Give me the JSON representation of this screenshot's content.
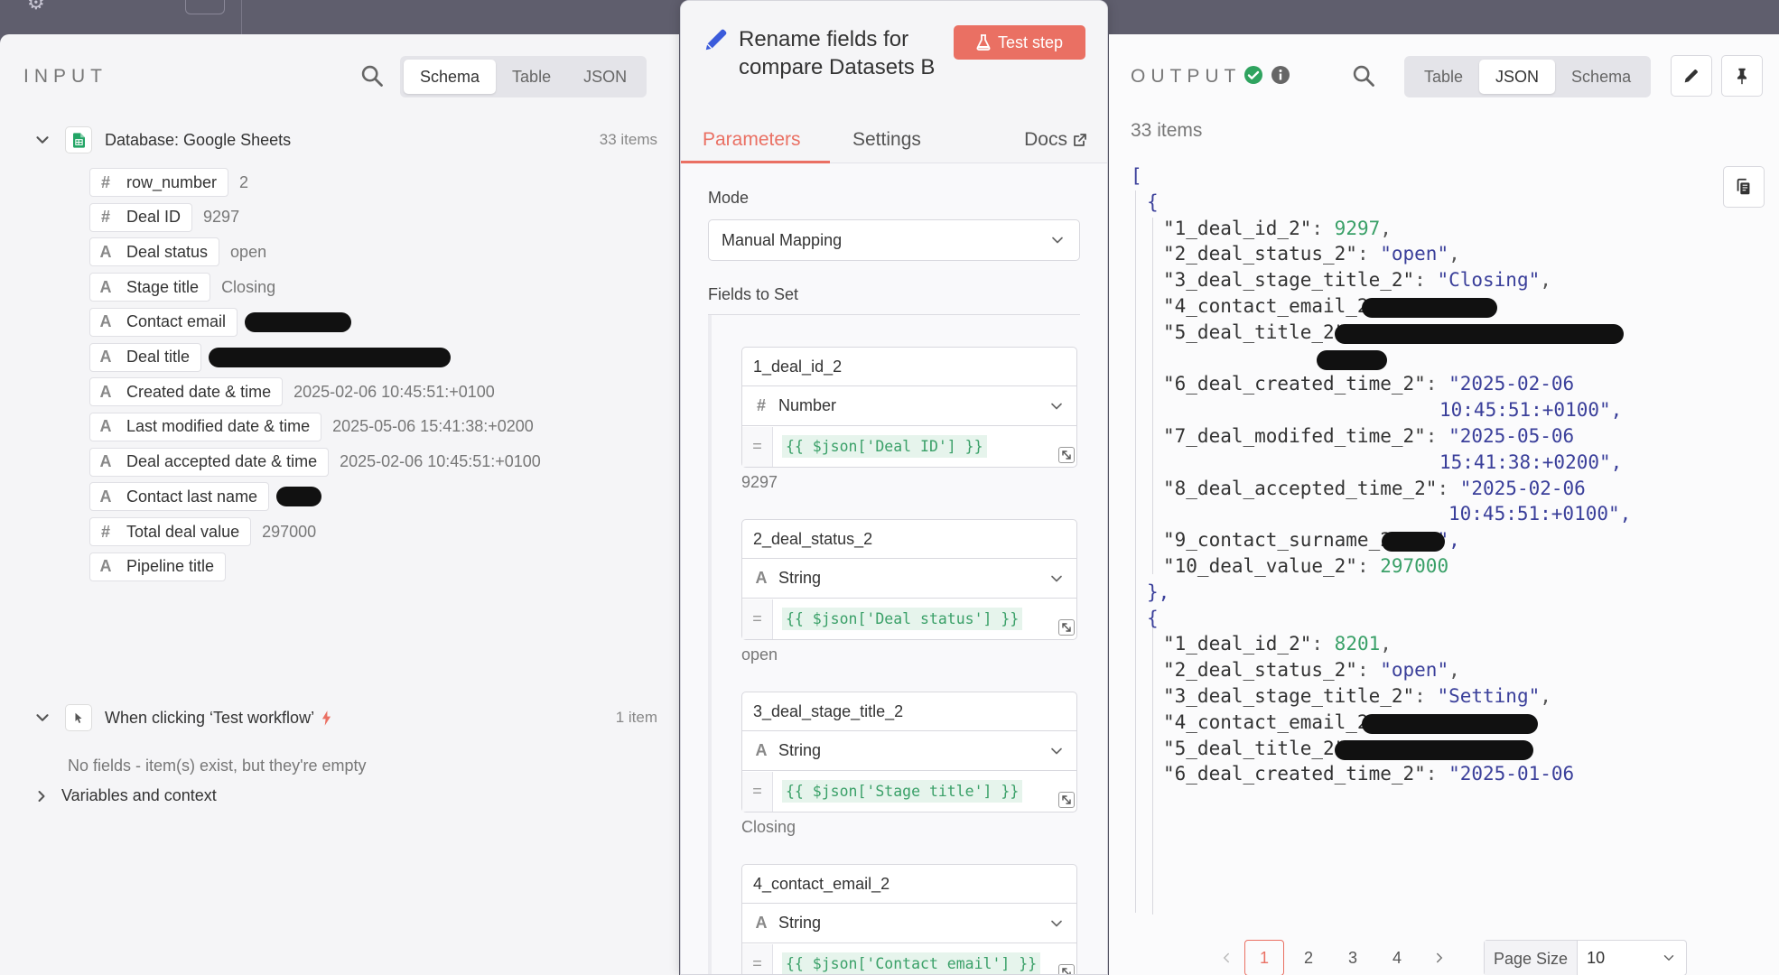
{
  "input": {
    "title": "INPUT",
    "view_tabs": [
      "Schema",
      "Table",
      "JSON"
    ],
    "active_view": 0,
    "nodes": [
      {
        "label": "Database: Google Sheets",
        "count": "33 items",
        "fields": [
          {
            "type": "#",
            "name": "row_number",
            "value": "2"
          },
          {
            "type": "#",
            "name": "Deal ID",
            "value": "9297"
          },
          {
            "type": "A",
            "name": "Deal status",
            "value": "open"
          },
          {
            "type": "A",
            "name": "Stage title",
            "value": "Closing"
          },
          {
            "type": "A",
            "name": "Contact email",
            "value": ""
          },
          {
            "type": "A",
            "name": "Deal title",
            "value": ""
          },
          {
            "type": "A",
            "name": "Created date & time",
            "value": "2025-02-06 10:45:51:+0100"
          },
          {
            "type": "A",
            "name": "Last modified date & time",
            "value": "2025-05-06 15:41:38:+0200"
          },
          {
            "type": "A",
            "name": "Deal accepted date & time",
            "value": "2025-02-06 10:45:51:+0100"
          },
          {
            "type": "A",
            "name": "Contact last name",
            "value": ""
          },
          {
            "type": "#",
            "name": "Total deal value",
            "value": "297000"
          },
          {
            "type": "A",
            "name": "Pipeline title",
            "value": ""
          }
        ]
      },
      {
        "label": "When clicking ‘Test workflow’",
        "count": "1 item",
        "empty_note": "No fields - item(s) exist, but they're empty"
      }
    ],
    "variables_label": "Variables and context"
  },
  "node": {
    "title": "Rename fields for compare Datasets B",
    "test_button": "Test step",
    "tabs": [
      "Parameters",
      "Settings"
    ],
    "docs_link": "Docs",
    "mode_label": "Mode",
    "mode_value": "Manual Mapping",
    "fields_label": "Fields to Set",
    "assignments": [
      {
        "name": "1_deal_id_2",
        "type_icon": "#",
        "type": "Number",
        "expression": "{{ $json['Deal ID'] }}",
        "result": "9297"
      },
      {
        "name": "2_deal_status_2",
        "type_icon": "A",
        "type": "String",
        "expression": "{{ $json['Deal status'] }}",
        "result": "open"
      },
      {
        "name": "3_deal_stage_title_2",
        "type_icon": "A",
        "type": "String",
        "expression": "{{ $json['Stage title'] }}",
        "result": "Closing"
      },
      {
        "name": "4_contact_email_2",
        "type_icon": "A",
        "type": "String",
        "expression": "{{ $json['Contact email'] }}",
        "result": ""
      }
    ]
  },
  "output": {
    "title": "OUTPUT",
    "view_tabs": [
      "Table",
      "JSON",
      "Schema"
    ],
    "active_view": 1,
    "items_count": "33 items",
    "json_lines": [
      {
        "t": "[",
        "cls": "brk"
      },
      {
        "t": "{",
        "cls": "brk"
      },
      {
        "k": "\"1_deal_id_2\"",
        "v": "9297",
        "vc": "num",
        "tail": ","
      },
      {
        "k": "\"2_deal_status_2\"",
        "v": "\"open\"",
        "vc": "str",
        "tail": ","
      },
      {
        "k": "\"3_deal_stage_title_2\"",
        "v": "\"Closing\"",
        "vc": "str",
        "tail": ","
      },
      {
        "k": "\"4_contact_email_2\"",
        "v": "\"",
        "vc": "str",
        "tail": "\","
      },
      {
        "k": "\"5_deal_title_2\"",
        "v": "\"",
        "vc": "str",
        "tail": ""
      },
      {
        "t": "\",",
        "cls": "str"
      },
      {
        "k": "\"6_deal_created_time_2\"",
        "v": "\"2025-02-06",
        "vc": "str",
        "tail": ""
      },
      {
        "t": "10:45:51:+0100\",",
        "cls": "str"
      },
      {
        "k": "\"7_deal_modifed_time_2\"",
        "v": "\"2025-05-06",
        "vc": "str",
        "tail": ""
      },
      {
        "t": "15:41:38:+0200\",",
        "cls": "str"
      },
      {
        "k": "\"8_deal_accepted_time_2\"",
        "v": "\"2025-02-06",
        "vc": "str",
        "tail": ""
      },
      {
        "t": "10:45:51:+0100\",",
        "cls": "str"
      },
      {
        "k": "\"9_contact_surname_2\"",
        "v": "\"",
        "vc": "str",
        "tail": "\","
      },
      {
        "k": "\"10_deal_value_2\"",
        "v": "297000",
        "vc": "num",
        "tail": ""
      },
      {
        "t": "},",
        "cls": "brk"
      },
      {
        "t": "{",
        "cls": "brk"
      },
      {
        "k": "\"1_deal_id_2\"",
        "v": "8201",
        "vc": "num",
        "tail": ","
      },
      {
        "k": "\"2_deal_status_2\"",
        "v": "\"open\"",
        "vc": "str",
        "tail": ","
      },
      {
        "k": "\"3_deal_stage_title_2\"",
        "v": "\"Setting\"",
        "vc": "str",
        "tail": ","
      },
      {
        "k": "\"4_contact_email_2\"",
        "v": "\"",
        "vc": "str",
        "tail": "\","
      },
      {
        "k": "\"5_deal_title_2\"",
        "v": "\"",
        "vc": "str",
        "tail": "\","
      },
      {
        "k": "\"6_deal_created_time_2\"",
        "v": "\"2025-01-06",
        "vc": "str",
        "tail": ""
      }
    ],
    "pages": [
      "1",
      "2",
      "3",
      "4"
    ],
    "active_page": 0,
    "page_size_label": "Page Size",
    "page_size_value": "10"
  },
  "colors": {
    "accent": "#ea7063",
    "success": "#2fa35f",
    "json_string": "#3a3f9a",
    "json_number": "#3aa068"
  }
}
